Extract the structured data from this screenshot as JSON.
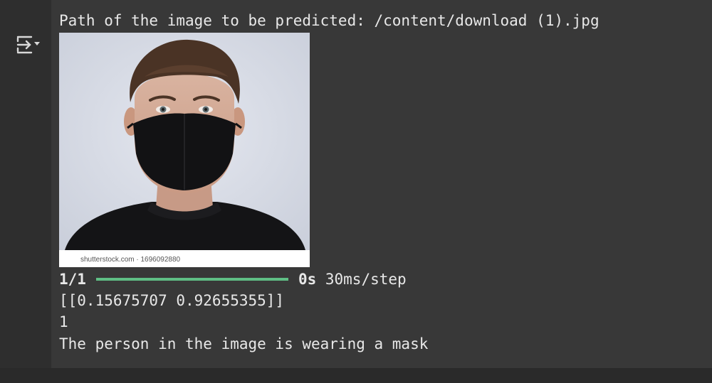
{
  "output": {
    "path_text": "Path of the image to be predicted: /content/download (1).jpg",
    "image": {
      "watermark": "shutterstock.com · 1696092880"
    },
    "progress": {
      "step": "1/1",
      "fraction": 1.0,
      "time": "0s",
      "rate": " 30ms/step"
    },
    "prediction_array": "[[0.15675707 0.92655355]]",
    "predicted_class": "1",
    "result_text": "The person in the image is wearing a mask"
  },
  "icons": {
    "toggle": "output-toggle-icon"
  },
  "colors": {
    "background": "#383838",
    "gutter": "#2e2e2e",
    "progress": "#5fbf85",
    "text": "#e8e8e8"
  }
}
